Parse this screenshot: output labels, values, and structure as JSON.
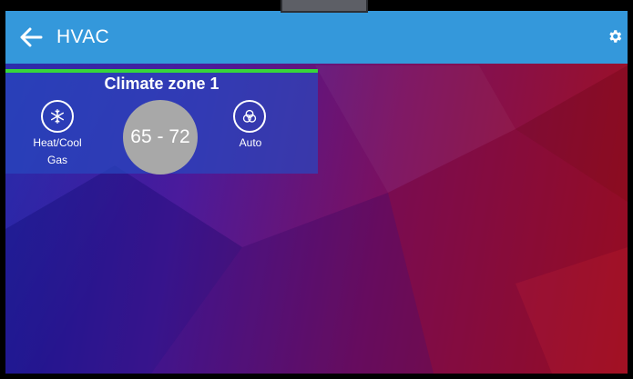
{
  "header": {
    "title": "HVAC",
    "back_icon": "arrow-left-icon",
    "settings_icon": "gear-icon",
    "color": "#3498db"
  },
  "zone": {
    "name": "Climate zone 1",
    "mode_label": "Heat/Cool",
    "fuel_label": "Gas",
    "setpoint": "65 - 72",
    "fan_label": "Auto",
    "mode_icon": "snowflake-icon",
    "fan_icon": "fan-icon",
    "status_color": "#37d63a"
  }
}
